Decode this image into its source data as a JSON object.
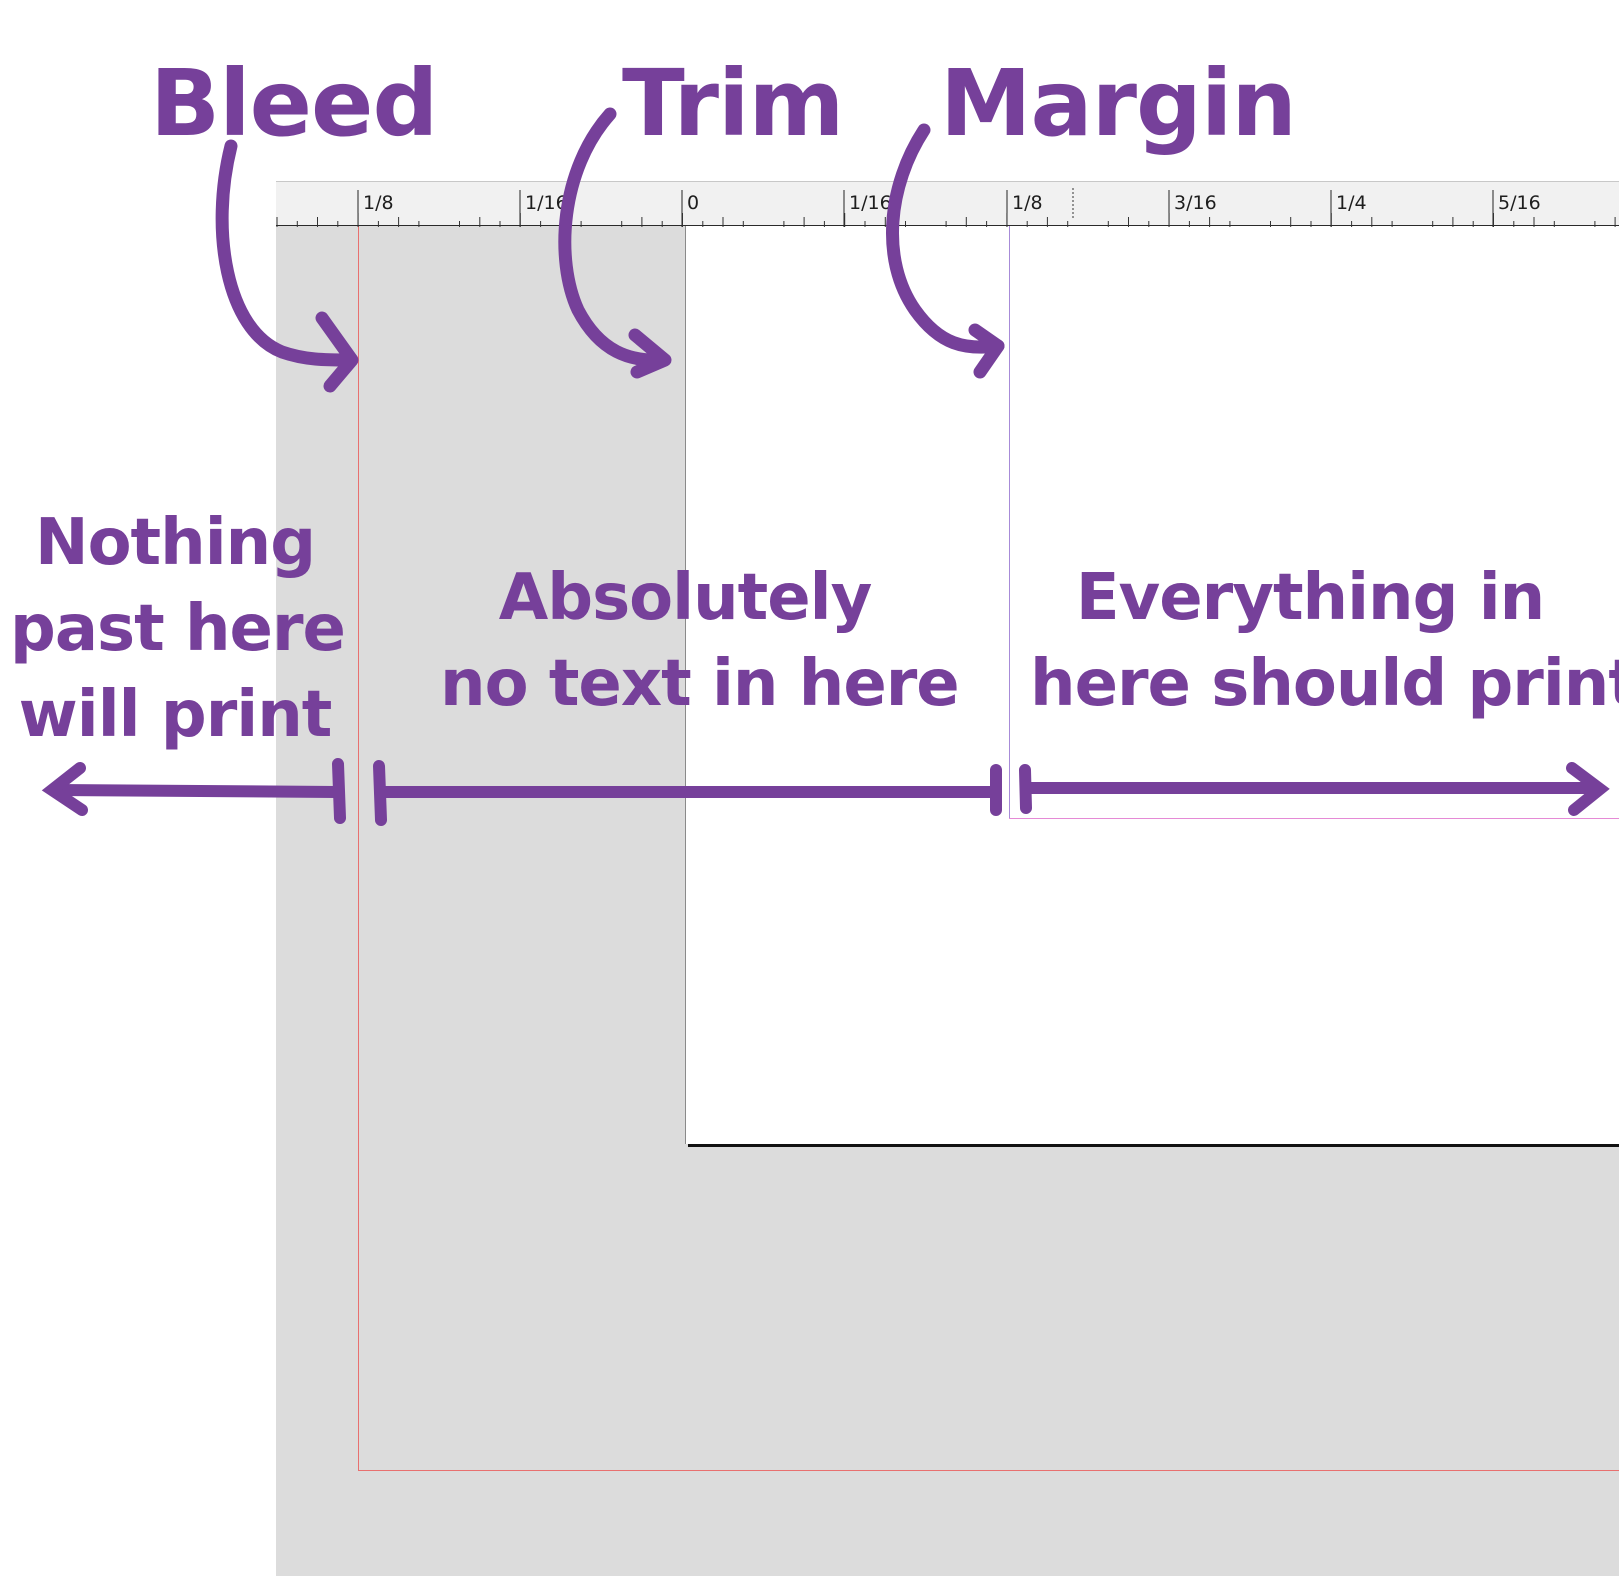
{
  "labels": {
    "bleed": "Bleed",
    "trim": "Trim",
    "margin": "Margin"
  },
  "zones": {
    "nothing": {
      "line1": "Nothing",
      "line2": "past here",
      "line3": "will print"
    },
    "absolutely": {
      "line1": "Absolutely",
      "line2": "no text in here"
    },
    "everything": {
      "line1": "Everything in",
      "line2": "here should print"
    }
  },
  "ruler": {
    "labels": [
      "1/8",
      "1/16",
      "0",
      "1/16",
      "1/8",
      "3/16",
      "1/4",
      "5/16"
    ]
  },
  "colors": {
    "annotation": "#76409a",
    "pasteboard": "#dcdcdc",
    "bleed_guide": "#e8706f",
    "margin_guide": "#a78bd8"
  }
}
